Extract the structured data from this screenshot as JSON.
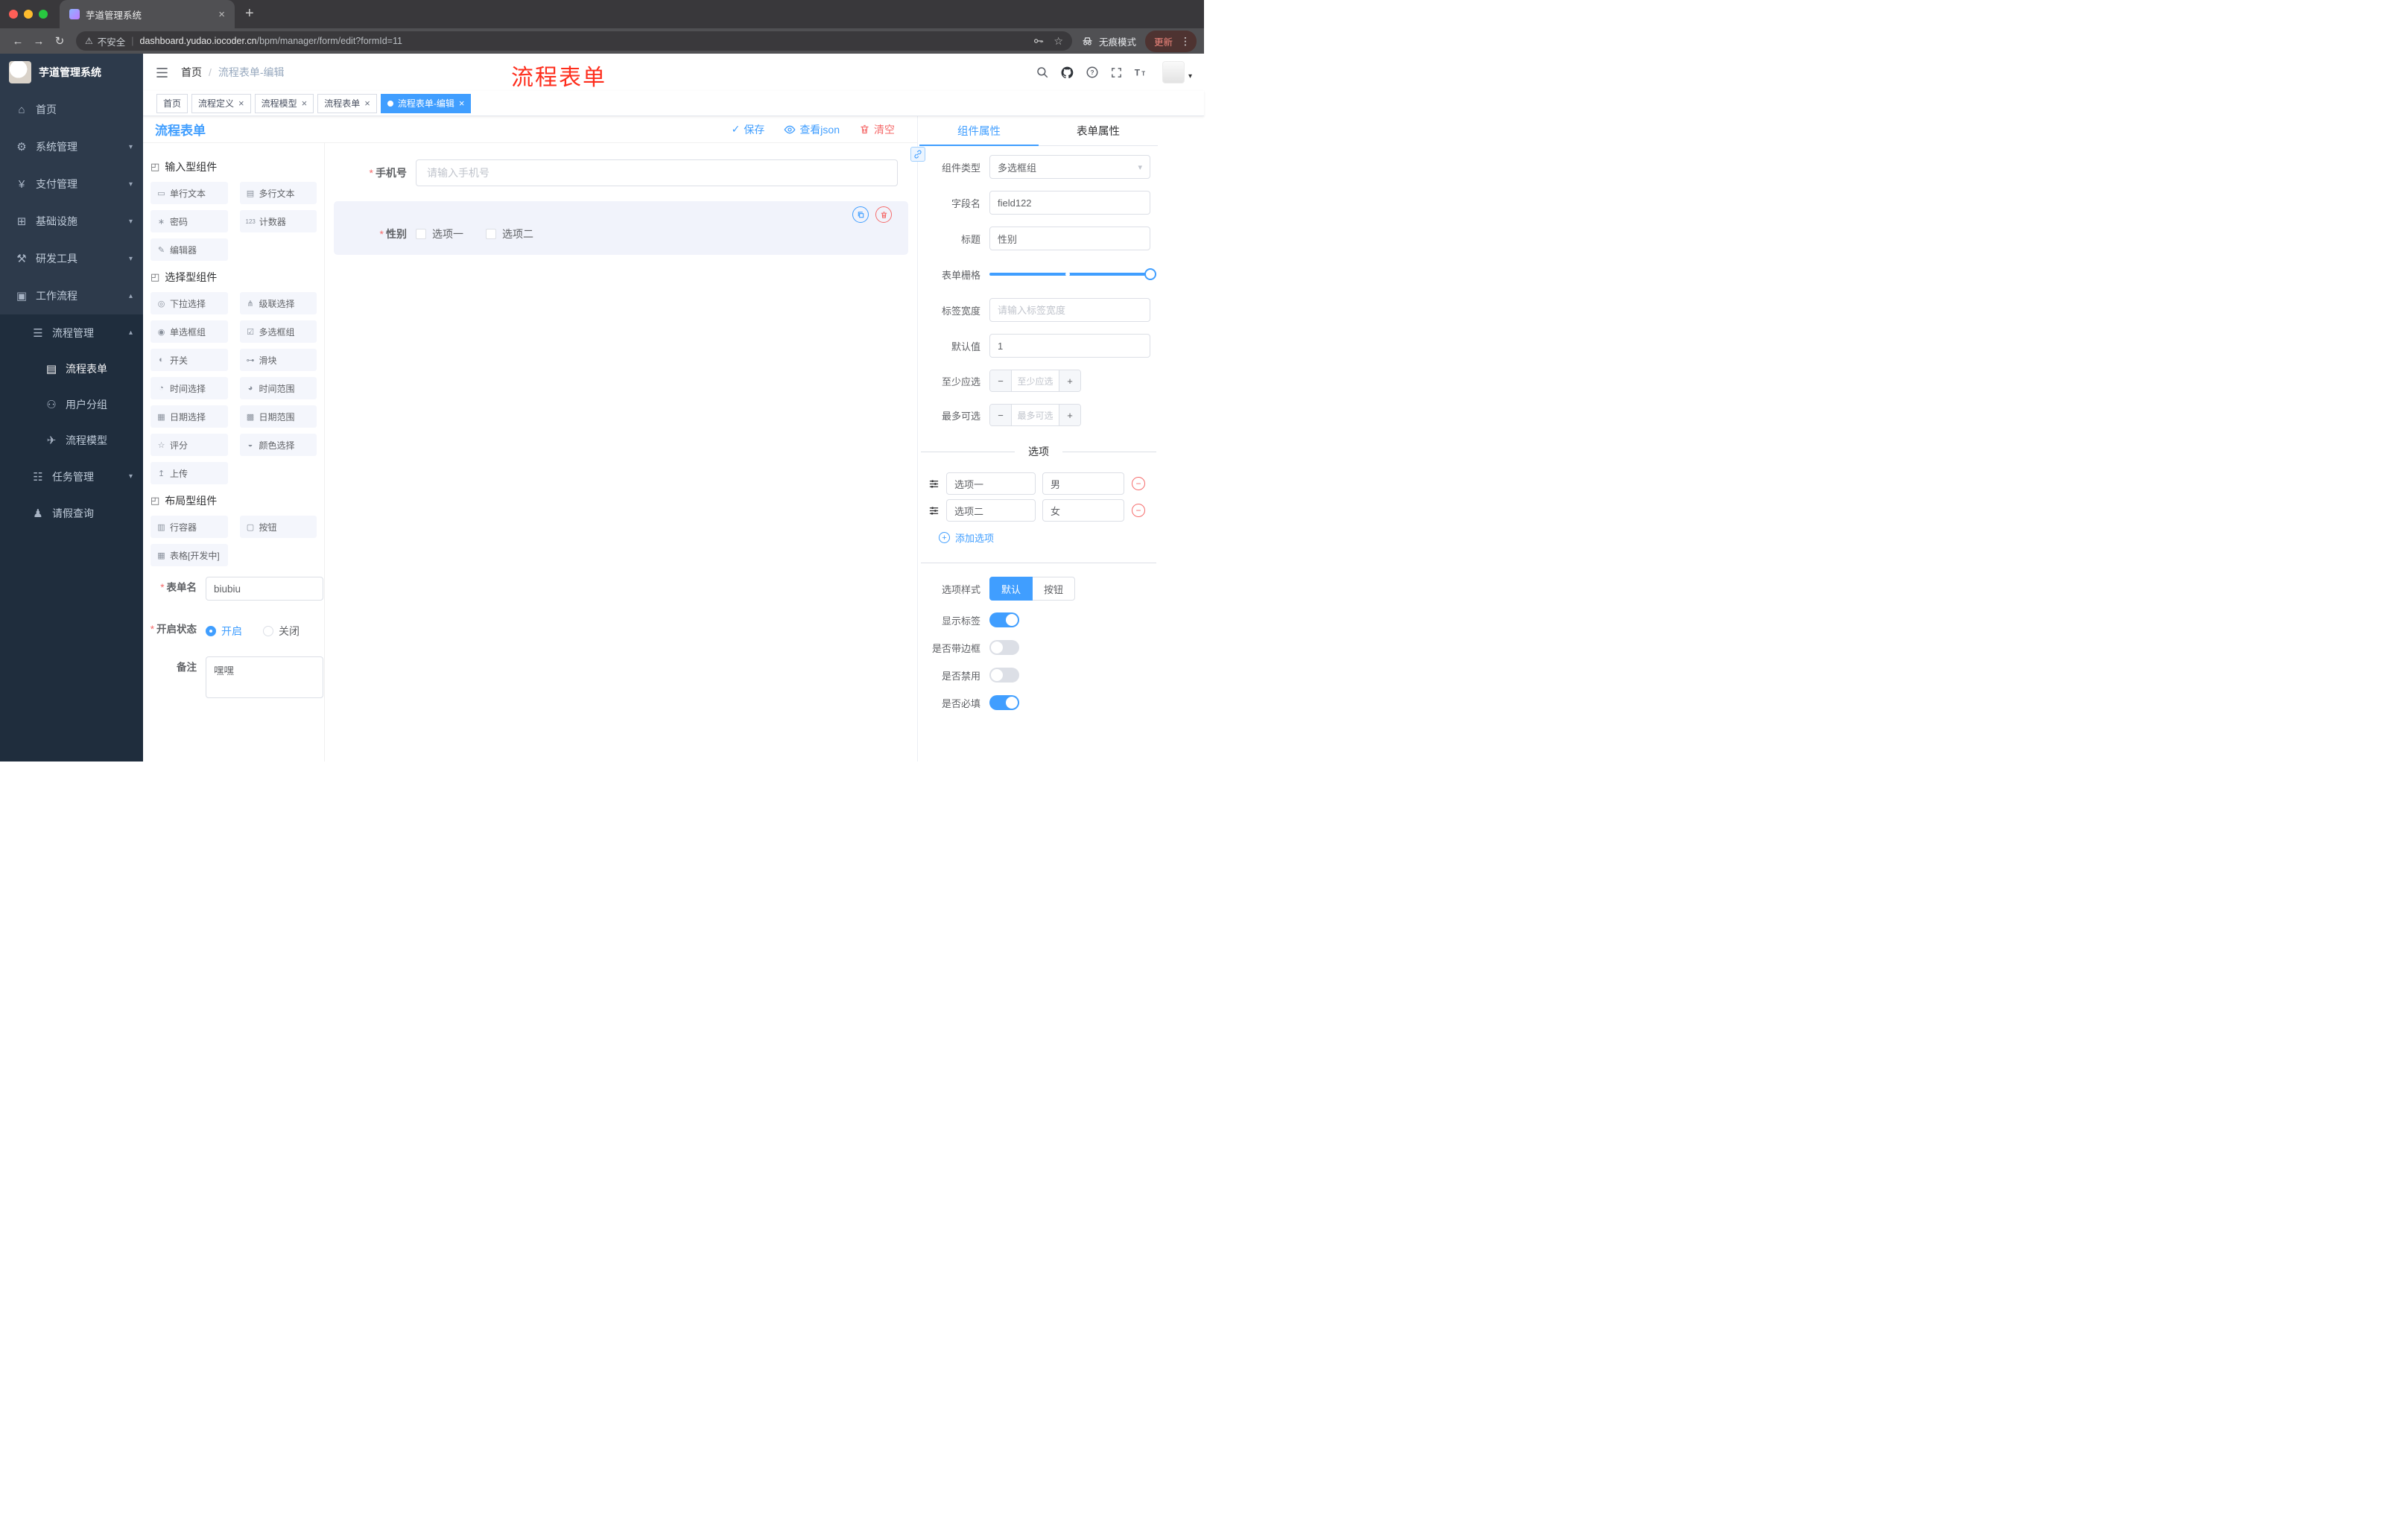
{
  "ui": {
    "close": "×",
    "plus": "+",
    "check": "✓",
    "caret_down": "▾",
    "caret_up": "▴",
    "star_outline": "☆",
    "warn": "⚠",
    "back": "←",
    "forward": "→",
    "reload": "↻",
    "dots_vertical": "⋮",
    "asterisk": "*",
    "minus": "−",
    "pipe": "|",
    "slash": "/"
  },
  "browser": {
    "tab_title": "芋道管理系统",
    "security_label": "不安全",
    "url_host": "dashboard.yudao.iocoder.cn",
    "url_path": "/bpm/manager/form/edit?formId=11",
    "incognito_label": "无痕模式",
    "update_label": "更新"
  },
  "sidebar": {
    "logo_title": "芋道管理系统",
    "items": [
      {
        "icon": "home-icon",
        "glyph": "⌂",
        "label": "首页",
        "chevron": ""
      },
      {
        "icon": "gear-icon",
        "glyph": "⚙",
        "label": "系统管理",
        "chevron": "▾"
      },
      {
        "icon": "payment-icon",
        "glyph": "¥",
        "label": "支付管理",
        "chevron": "▾"
      },
      {
        "icon": "infrastructure-icon",
        "glyph": "⊞",
        "label": "基础设施",
        "chevron": "▾"
      },
      {
        "icon": "devtools-icon",
        "glyph": "⚒",
        "label": "研发工具",
        "chevron": "▾"
      },
      {
        "icon": "workflow-icon",
        "glyph": "▣",
        "label": "工作流程",
        "chevron": "▴"
      }
    ],
    "sub_items": [
      {
        "icon": "process-manage-icon",
        "glyph": "☰",
        "label": "流程管理",
        "chevron": "▴"
      },
      {
        "icon": "process-form-icon",
        "glyph": "▤",
        "label": "流程表单",
        "chevron": ""
      },
      {
        "icon": "user-group-icon",
        "glyph": "⚇",
        "label": "用户分组",
        "chevron": ""
      },
      {
        "icon": "process-model-icon",
        "glyph": "✈",
        "label": "流程模型",
        "chevron": ""
      },
      {
        "icon": "task-manage-icon",
        "glyph": "☷",
        "label": "任务管理",
        "chevron": "▾"
      },
      {
        "icon": "leave-query-icon",
        "glyph": "♟",
        "label": "请假查询",
        "chevron": ""
      }
    ]
  },
  "header": {
    "breadcrumb_home": "首页",
    "breadcrumb_current": "流程表单-编辑",
    "annotation": "流程表单"
  },
  "tags": [
    {
      "label": "首页",
      "closable": false,
      "active": false
    },
    {
      "label": "流程定义",
      "closable": true,
      "active": false
    },
    {
      "label": "流程模型",
      "closable": true,
      "active": false
    },
    {
      "label": "流程表单",
      "closable": true,
      "active": false
    },
    {
      "label": "流程表单-编辑",
      "closable": true,
      "active": true
    }
  ],
  "toolbar": {
    "title": "流程表单",
    "save_label": "保存",
    "view_json_label": "查看json",
    "clear_label": "清空"
  },
  "palette": {
    "groups": [
      {
        "title": "输入型组件",
        "icon_glyph": "◰",
        "items": [
          {
            "icon": "single-line-text-icon",
            "glyph": "▭",
            "label": "单行文本"
          },
          {
            "icon": "multi-line-text-icon",
            "glyph": "▤",
            "label": "多行文本"
          },
          {
            "icon": "password-icon",
            "glyph": "∗",
            "label": "密码"
          },
          {
            "icon": "counter-icon",
            "glyph": "123",
            "label": "计数器"
          },
          {
            "icon": "editor-icon",
            "glyph": "✎",
            "label": "编辑器"
          }
        ]
      },
      {
        "title": "选择型组件",
        "icon_glyph": "◰",
        "items": [
          {
            "icon": "select-icon",
            "glyph": "◎",
            "label": "下拉选择"
          },
          {
            "icon": "cascader-icon",
            "glyph": "⋔",
            "label": "级联选择"
          },
          {
            "icon": "radio-group-icon",
            "glyph": "◉",
            "label": "单选框组"
          },
          {
            "icon": "checkbox-group-icon",
            "glyph": "☑",
            "label": "多选框组"
          },
          {
            "icon": "switch-icon",
            "glyph": "◐",
            "label": "开关"
          },
          {
            "icon": "slider-icon",
            "glyph": "⊶",
            "label": "滑块"
          },
          {
            "icon": "time-picker-icon",
            "glyph": "◔",
            "label": "时间选择"
          },
          {
            "icon": "time-range-icon",
            "glyph": "◕",
            "label": "时间范围"
          },
          {
            "icon": "date-picker-icon",
            "glyph": "▦",
            "label": "日期选择"
          },
          {
            "icon": "date-range-icon",
            "glyph": "▩",
            "label": "日期范围"
          },
          {
            "icon": "rate-icon",
            "glyph": "☆",
            "label": "评分"
          },
          {
            "icon": "color-picker-icon",
            "glyph": "◒",
            "label": "颜色选择"
          },
          {
            "icon": "upload-icon",
            "glyph": "↥",
            "label": "上传"
          }
        ]
      },
      {
        "title": "布局型组件",
        "icon_glyph": "◰",
        "items": [
          {
            "icon": "row-container-icon",
            "glyph": "▥",
            "label": "行容器"
          },
          {
            "icon": "button-icon",
            "glyph": "▢",
            "label": "按钮"
          },
          {
            "icon": "table-icon",
            "glyph": "▦",
            "label": "表格[开发中]"
          }
        ]
      }
    ]
  },
  "form_config": {
    "name_label": "表单名",
    "name_value": "biubiu",
    "status_label": "开启状态",
    "status_on": "开启",
    "status_off": "关闭",
    "remark_label": "备注",
    "remark_value": "嘿嘿"
  },
  "canvas": {
    "phone_label": "手机号",
    "phone_placeholder": "请输入手机号",
    "gender_label": "性别",
    "gender_option1": "选项一",
    "gender_option2": "选项二"
  },
  "props": {
    "tab_component": "组件属性",
    "tab_form": "表单属性",
    "component_type_label": "组件类型",
    "component_type_value": "多选框组",
    "field_name_label": "字段名",
    "field_name_value": "field122",
    "title_label": "标题",
    "title_value": "性别",
    "grid_label": "表单栅格",
    "label_width_label": "标签宽度",
    "label_width_placeholder": "请输入标签宽度",
    "default_label": "默认值",
    "default_value": "1",
    "min_label": "至少应选",
    "min_placeholder": "至少应选",
    "max_label": "最多可选",
    "max_placeholder": "最多可选",
    "options_title": "选项",
    "options": [
      {
        "label": "选项一",
        "value": "男"
      },
      {
        "label": "选项二",
        "value": "女"
      }
    ],
    "add_option_label": "添加选项",
    "style_label": "选项样式",
    "style_default": "默认",
    "style_button": "按钮",
    "toggles": [
      {
        "label": "显示标签",
        "on": true
      },
      {
        "label": "是否带边框",
        "on": false
      },
      {
        "label": "是否禁用",
        "on": false
      },
      {
        "label": "是否必填",
        "on": true
      }
    ]
  },
  "colors": {
    "primary": "#409EFF",
    "danger": "#F56C6C",
    "annotation": "#FE2D1C"
  }
}
